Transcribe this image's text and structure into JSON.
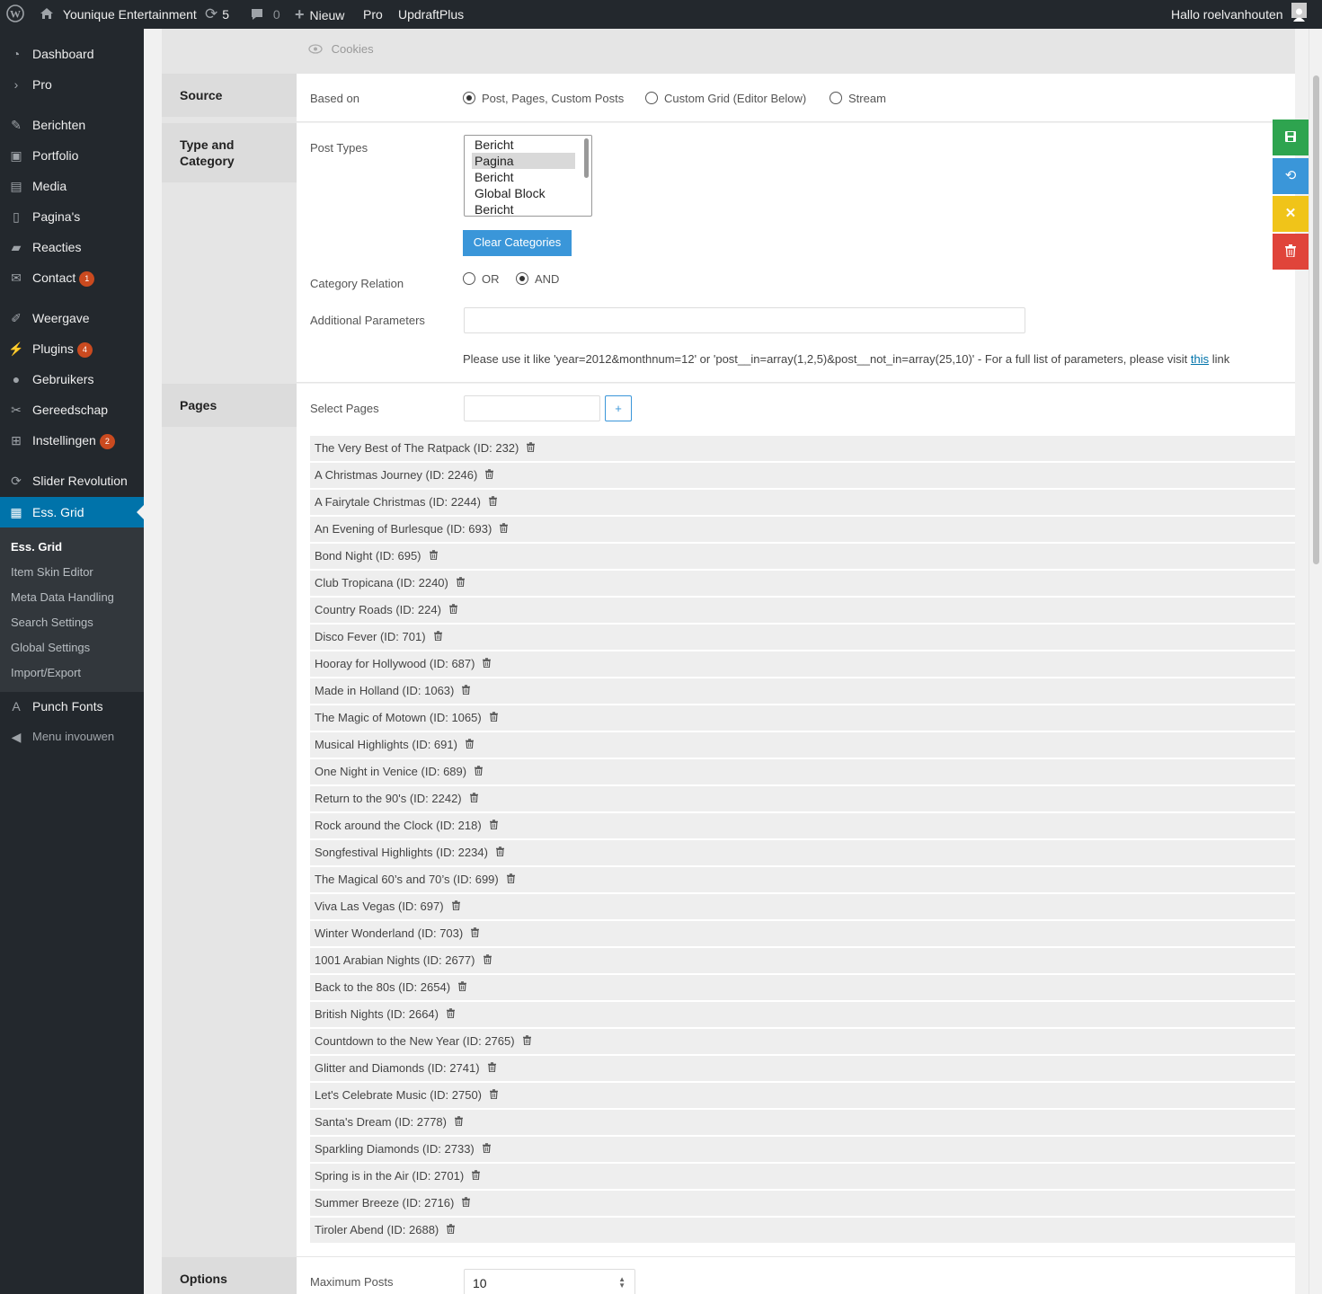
{
  "adminbar": {
    "site_name": "Younique Entertainment",
    "updates_count": "5",
    "comments_count": "0",
    "new_label": "Nieuw",
    "pro_label": "Pro",
    "updraft_label": "UpdraftPlus",
    "greeting": "Hallo roelvanhouten"
  },
  "sidebar": {
    "items": [
      {
        "label": "Dashboard",
        "icon": "dashboard-icon"
      },
      {
        "label": "Pro",
        "icon": "chevron-right-icon"
      },
      {
        "label": "Berichten",
        "icon": "pin-icon"
      },
      {
        "label": "Portfolio",
        "icon": "portfolio-icon"
      },
      {
        "label": "Media",
        "icon": "media-icon"
      },
      {
        "label": "Pagina's",
        "icon": "pages-icon"
      },
      {
        "label": "Reacties",
        "icon": "comments-icon"
      },
      {
        "label": "Contact",
        "icon": "mail-icon",
        "badge": "1"
      },
      {
        "label": "Weergave",
        "icon": "brush-icon"
      },
      {
        "label": "Plugins",
        "icon": "plugins-icon",
        "badge": "4"
      },
      {
        "label": "Gebruikers",
        "icon": "users-icon"
      },
      {
        "label": "Gereedschap",
        "icon": "wrench-icon"
      },
      {
        "label": "Instellingen",
        "icon": "settings-icon",
        "badge": "2"
      },
      {
        "label": "Slider Revolution",
        "icon": "refresh-icon"
      },
      {
        "label": "Ess. Grid",
        "icon": "grid-icon"
      },
      {
        "label": "Punch Fonts",
        "icon": "font-icon"
      },
      {
        "label": "Menu invouwen",
        "icon": "collapse-icon"
      }
    ],
    "submenu": [
      "Ess. Grid",
      "Item Skin Editor",
      "Meta Data Handling",
      "Search Settings",
      "Global Settings",
      "Import/Export"
    ]
  },
  "header_tab": "Cookies",
  "sections": {
    "source": "Source",
    "type_category": "Type and Category",
    "pages": "Pages",
    "options": "Options"
  },
  "source": {
    "based_on_label": "Based on",
    "options": [
      "Post, Pages, Custom Posts",
      "Custom Grid (Editor Below)",
      "Stream"
    ],
    "selected": "Post, Pages, Custom Posts"
  },
  "type_category": {
    "post_types_label": "Post Types",
    "post_types": [
      "Bericht",
      "Pagina",
      "Bericht",
      "Global Block",
      "Bericht"
    ],
    "selected_post_type": "Pagina",
    "clear_button": "Clear Categories",
    "relation_label": "Category Relation",
    "relation_or": "OR",
    "relation_and": "AND",
    "relation_selected": "AND",
    "additional_label": "Additional Parameters",
    "additional_value": "",
    "hint_text": "Please use it like 'year=2012&monthnum=12' or 'post__in=array(1,2,5)&post__not_in=array(25,10)' -  For a full list of parameters, please visit",
    "hint_link": "this",
    "hint_suffix": "link"
  },
  "pages": {
    "select_label": "Select Pages",
    "search_value": "",
    "add_button": "+",
    "items": [
      "The Very Best of The Ratpack (ID: 232)",
      "A Christmas Journey (ID: 2246)",
      "A Fairytale Christmas (ID: 2244)",
      "An Evening of Burlesque (ID: 693)",
      "Bond Night (ID: 695)",
      "Club Tropicana (ID: 2240)",
      "Country Roads (ID: 224)",
      "Disco Fever (ID: 701)",
      "Hooray for Hollywood (ID: 687)",
      "Made in Holland (ID: 1063)",
      "The Magic of Motown (ID: 1065)",
      "Musical Highlights (ID: 691)",
      "One Night in Venice (ID: 689)",
      "Return to the 90's (ID: 2242)",
      "Rock around the Clock (ID: 218)",
      "Songfestival Highlights (ID: 2234)",
      "The Magical 60’s and 70’s (ID: 699)",
      "Viva Las Vegas (ID: 697)",
      "Winter Wonderland (ID: 703)",
      "1001 Arabian Nights (ID: 2677)",
      "Back to the 80s (ID: 2654)",
      "British Nights (ID: 2664)",
      "Countdown to the New Year (ID: 2765)",
      "Glitter and Diamonds (ID: 2741)",
      "Let's Celebrate Music (ID: 2750)",
      "Santa's Dream (ID: 2778)",
      "Sparkling Diamonds (ID: 2733)",
      "Spring is in the Air (ID: 2701)",
      "Summer Breeze (ID: 2716)",
      "Tiroler Abend (ID: 2688)"
    ]
  },
  "options": {
    "max_posts_label": "Maximum Posts",
    "max_posts_value": "10"
  },
  "colors": {
    "save": "#2ea44f",
    "refresh": "#3a96d9",
    "close": "#f0c419",
    "delete": "#e0443a",
    "accent": "#0073aa"
  }
}
